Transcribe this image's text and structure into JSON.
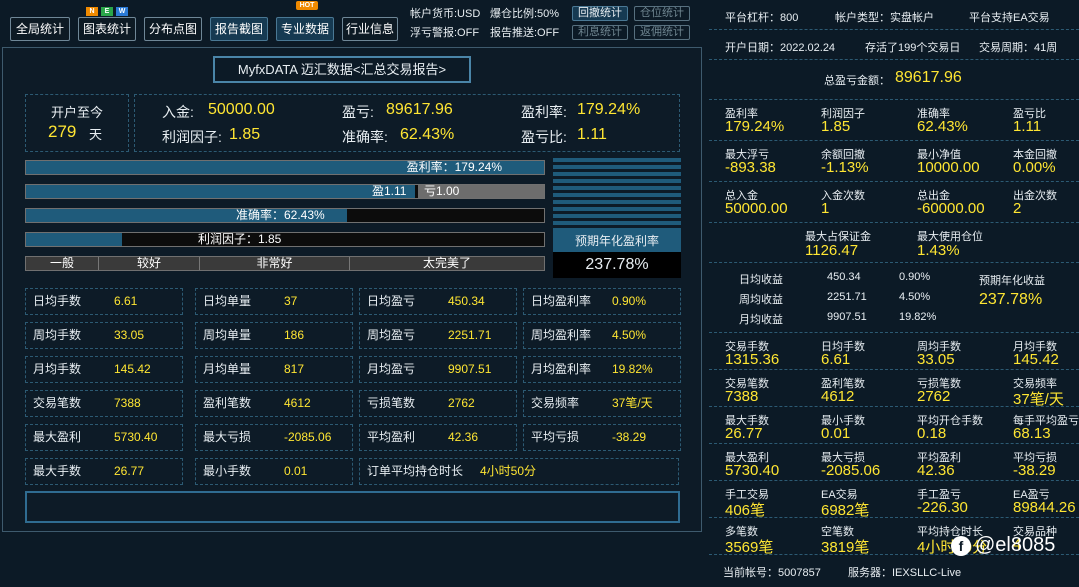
{
  "toolbar": {
    "buttons": [
      "全局统计",
      "图表统计",
      "分布点图",
      "报告截图",
      "专业数据",
      "行业信息"
    ],
    "badges": [
      "N",
      "E",
      "W"
    ],
    "hot": "HOT",
    "account_currency": "帐户货币:USD",
    "float_warn": "浮亏警报:OFF",
    "leverage_ratio": "爆仓比例:50%",
    "report_push": "报告推送:OFF",
    "retrace_btn": "回撤统计",
    "position_btn": "仓位统计",
    "interest_btn": "利息统计",
    "rebate_btn": "返佣统计"
  },
  "main": {
    "title": "MyfxDATA 迈汇数据<汇总交易报告>",
    "since_label": "开户至今",
    "since_value": "279",
    "since_unit": "天",
    "deposit_label": "入金:",
    "deposit_value": "50000.00",
    "profit_label": "盈亏:",
    "profit_value": "89617.96",
    "profit_rate_label": "盈利率:",
    "profit_rate_value": "179.24%",
    "profit_factor_label": "利润因子:",
    "profit_factor_value": "1.85",
    "accuracy_label": "准确率:",
    "accuracy_value": "62.43%",
    "pl_ratio_label": "盈亏比:",
    "pl_ratio_value": "1.11",
    "bars": {
      "profit_rate": {
        "text": "盈利率：179.24%",
        "fill": 1.0
      },
      "win": {
        "text": "盈1.11",
        "fill": 0.75
      },
      "loss": {
        "text": "亏1.00"
      },
      "accuracy": {
        "text": "准确率：62.43%",
        "fill": 0.62
      },
      "profit_factor": {
        "text": "利润因子：1.85",
        "fill": 0.185
      }
    },
    "grades": [
      "一般",
      "较好",
      "非常好",
      "太完美了"
    ],
    "annual_label": "预期年化盈利率",
    "annual_value": "237.78%",
    "grid": [
      [
        [
          "日均手数",
          "6.61"
        ],
        [
          "日均单量",
          "37"
        ],
        [
          "日均盈亏",
          "450.34"
        ],
        [
          "日均盈利率",
          "0.90%"
        ]
      ],
      [
        [
          "周均手数",
          "33.05"
        ],
        [
          "周均单量",
          "186"
        ],
        [
          "周均盈亏",
          "2251.71"
        ],
        [
          "周均盈利率",
          "4.50%"
        ]
      ],
      [
        [
          "月均手数",
          "145.42"
        ],
        [
          "月均单量",
          "817"
        ],
        [
          "月均盈亏",
          "9907.51"
        ],
        [
          "月均盈利率",
          "19.82%"
        ]
      ],
      [
        [
          "交易笔数",
          "7388"
        ],
        [
          "盈利笔数",
          "4612"
        ],
        [
          "亏损笔数",
          "2762"
        ],
        [
          "交易频率",
          "37笔/天"
        ]
      ],
      [
        [
          "最大盈利",
          "5730.40"
        ],
        [
          "最大亏损",
          "-2085.06"
        ],
        [
          "平均盈利",
          "42.36"
        ],
        [
          "平均亏损",
          "-38.29"
        ]
      ]
    ],
    "last_row": [
      [
        "最大手数",
        "26.77"
      ],
      [
        "最小手数",
        "0.01"
      ]
    ],
    "hold_label": "订单平均持仓时长",
    "hold_value": "4小时50分"
  },
  "right": {
    "platform_leverage": "平台杠杆：800",
    "account_type": "帐户类型：实盘帐户",
    "ea_support": "平台支持EA交易",
    "open_date": "开户日期：2022.02.24",
    "active_days": "存活了199个交易日",
    "trade_weeks": "交易周期：41周",
    "total_label": "总盈亏金额：",
    "total_value": "89617.96",
    "rows": [
      [
        [
          "盈利率",
          "179.24%"
        ],
        [
          "利润因子",
          "1.85"
        ],
        [
          "准确率",
          "62.43%"
        ],
        [
          "盈亏比",
          "1.11"
        ]
      ],
      [
        [
          "最大浮亏",
          "-893.38"
        ],
        [
          "余额回撤",
          "-1.13%"
        ],
        [
          "最小净值",
          "10000.00"
        ],
        [
          "本金回撤",
          "0.00%"
        ]
      ],
      [
        [
          "总入金",
          "50000.00"
        ],
        [
          "入金次数",
          "1"
        ],
        [
          "总出金",
          "-60000.00"
        ],
        [
          "出金次数",
          "2"
        ]
      ]
    ],
    "margin_label": "最大占保证金",
    "margin_value": "1126.47",
    "usage_label": "最大使用仓位",
    "usage_value": "1.43%",
    "avg": [
      [
        "日均收益",
        "450.34",
        "0.90%"
      ],
      [
        "周均收益",
        "2251.71",
        "4.50%"
      ],
      [
        "月均收益",
        "9907.51",
        "19.82%"
      ]
    ],
    "annual_label": "预期年化收益",
    "annual_value": "237.78%",
    "rows2": [
      [
        [
          "交易手数",
          "1315.36"
        ],
        [
          "日均手数",
          "6.61"
        ],
        [
          "周均手数",
          "33.05"
        ],
        [
          "月均手数",
          "145.42"
        ]
      ],
      [
        [
          "交易笔数",
          "7388"
        ],
        [
          "盈利笔数",
          "4612"
        ],
        [
          "亏损笔数",
          "2762"
        ],
        [
          "交易频率",
          "37笔/天"
        ]
      ],
      [
        [
          "最大手数",
          "26.77"
        ],
        [
          "最小手数",
          "0.01"
        ],
        [
          "平均开仓手数",
          "0.18"
        ],
        [
          "每手平均盈亏",
          "68.13"
        ]
      ],
      [
        [
          "最大盈利",
          "5730.40"
        ],
        [
          "最大亏损",
          "-2085.06"
        ],
        [
          "平均盈利",
          "42.36"
        ],
        [
          "平均亏损",
          "-38.29"
        ]
      ],
      [
        [
          "手工交易",
          "406笔"
        ],
        [
          "EA交易",
          "6982笔"
        ],
        [
          "手工盈亏",
          "-226.30"
        ],
        [
          "EA盈亏",
          "89844.26"
        ]
      ],
      [
        [
          "多笔数",
          "3569笔"
        ],
        [
          "空笔数",
          "3819笔"
        ],
        [
          "平均持仓时长",
          "4小时50分"
        ],
        [
          "交易品种",
          "4"
        ]
      ]
    ],
    "account_no": "当前帐号：5007857",
    "server": "服务器：IEXSLLC-Live",
    "watermark": "@el8085"
  }
}
